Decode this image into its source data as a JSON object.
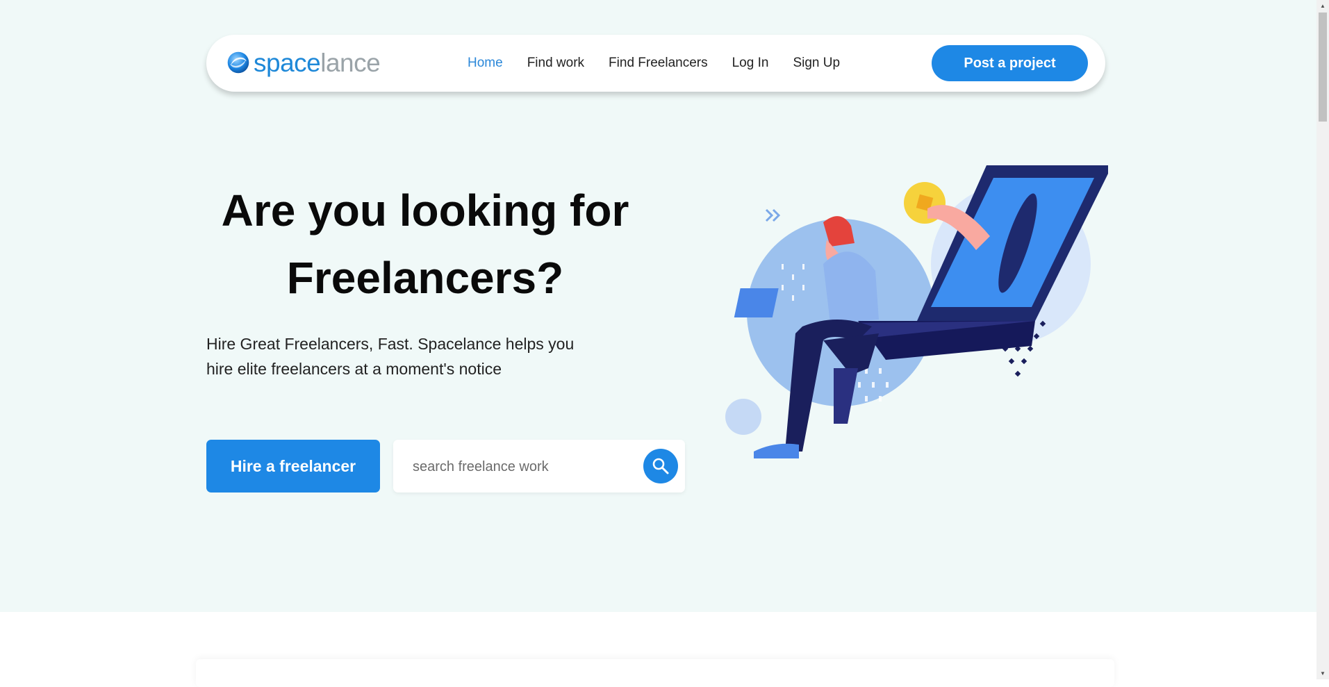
{
  "brand": {
    "name_part1": "space",
    "name_part2": "lance",
    "primary_color": "#1e88e5",
    "logo_icon": "swirl-globe-icon"
  },
  "nav": {
    "links": [
      {
        "label": "Home",
        "active": true
      },
      {
        "label": "Find work",
        "active": false
      },
      {
        "label": "Find Freelancers",
        "active": false
      },
      {
        "label": "Log In",
        "active": false
      },
      {
        "label": "Sign Up",
        "active": false
      }
    ],
    "cta_label": "Post a project"
  },
  "hero": {
    "headline_line1": "Are you looking for",
    "headline_line2": "Freelancers?",
    "subtext_line1": "Hire Great Freelancers, Fast. Spacelance helps you",
    "subtext_line2": "hire elite freelancers at a moment's notice",
    "hire_button_label": "Hire a freelancer",
    "search": {
      "placeholder": "search freelance work",
      "value": "",
      "button_icon": "search-icon"
    },
    "illustration_icon": "freelancer-laptop-illustration"
  }
}
